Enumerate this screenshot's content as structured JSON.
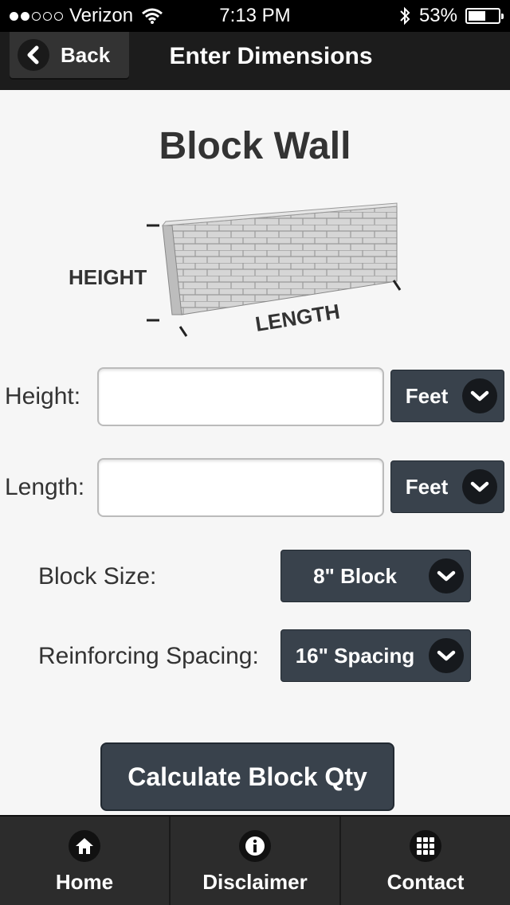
{
  "status": {
    "carrier": "Verizon",
    "time": "7:13 PM",
    "battery": "53%",
    "signal_bars": 2,
    "signal_max": 5
  },
  "header": {
    "back_label": "Back",
    "title": "Enter Dimensions"
  },
  "page": {
    "title": "Block Wall"
  },
  "illustration": {
    "height_label": "HEIGHT",
    "length_label": "LENGTH"
  },
  "form": {
    "height_label": "Height:",
    "length_label": "Length:",
    "height_unit": "Feet",
    "length_unit": "Feet",
    "height_value": "",
    "length_value": "",
    "block_size_label": "Block Size:",
    "block_size_value": "8\" Block",
    "spacing_label": "Reinforcing Spacing:",
    "spacing_value": "16\" Spacing"
  },
  "calc_button": "Calculate Block Qty",
  "tabs": [
    {
      "label": "Home",
      "icon": "home-icon"
    },
    {
      "label": "Disclaimer",
      "icon": "info-icon"
    },
    {
      "label": "Contact",
      "icon": "grid-icon"
    }
  ],
  "colors": {
    "button": "#39424c",
    "header": "#1c1c1c",
    "tabbar": "#2c2c2c",
    "background": "#f6f6f6"
  }
}
